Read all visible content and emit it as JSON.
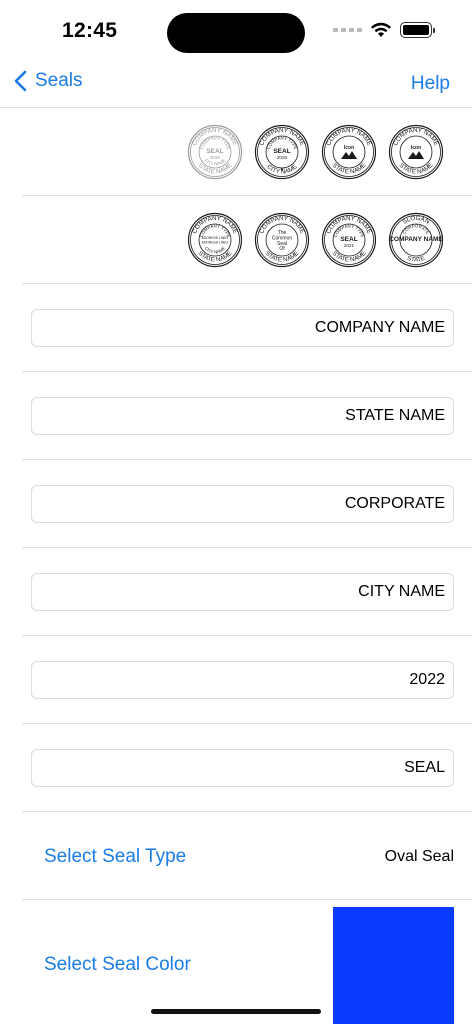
{
  "status": {
    "time": "12:45"
  },
  "nav": {
    "back_label": "Seals",
    "help_label": "Help"
  },
  "seals_row1": [
    {
      "top": "COMPANY NAME",
      "middle": "SEAL",
      "sub": "2020",
      "bottom": "STATE NAME",
      "inner": "COMPANY TYPE",
      "inner2": "CITY NAME",
      "faded": true
    },
    {
      "top": "COMPANY NAME",
      "middle": "SEAL",
      "sub": "2020",
      "bottom": "CITY NAME",
      "inner": "COMPANY TYPE",
      "inner2": "",
      "star": true
    },
    {
      "top": "COMPANY NAME",
      "middle": "Icon",
      "sub": "",
      "bottom": "STATE NAME",
      "inner": "",
      "inner2": ""
    },
    {
      "top": "COMPANY NAME",
      "middle": "Icon",
      "sub": "",
      "bottom": "STATE NAME",
      "inner": "",
      "inner2": ""
    }
  ],
  "seals_row2": [
    {
      "top": "COMPANY NAME",
      "middle": "ADDRESS LINE1",
      "sub": "ADDRESS LINE2",
      "bottom": "STATE NAME",
      "inner": "COMPANY TYPE",
      "inner2": "CITY NAME"
    },
    {
      "top": "COMPANY NAME",
      "middle": "The Common Seal",
      "sub": "Of",
      "bottom": "STATE NAME",
      "inner": "",
      "inner2": ""
    },
    {
      "top": "COMPANY NAME",
      "middle": "SEAL",
      "sub": "2021",
      "bottom": "STATE NAME",
      "inner": "COMPANY TYPE",
      "inner2": ""
    },
    {
      "top": "SLOGAN",
      "middle": "COMPANY NAME",
      "sub": "",
      "bottom": "STATE",
      "inner": "CORPORATE",
      "inner2": ""
    }
  ],
  "fields": {
    "company_name": "COMPANY NAME",
    "state_name": "STATE NAME",
    "corporate": "CORPORATE",
    "city_name": "CITY NAME",
    "year": "2022",
    "seal": "SEAL"
  },
  "seal_type": {
    "label": "Select Seal Type",
    "value": "Oval Seal"
  },
  "seal_color": {
    "label": "Select Seal Color",
    "color": "#0a3cff"
  }
}
